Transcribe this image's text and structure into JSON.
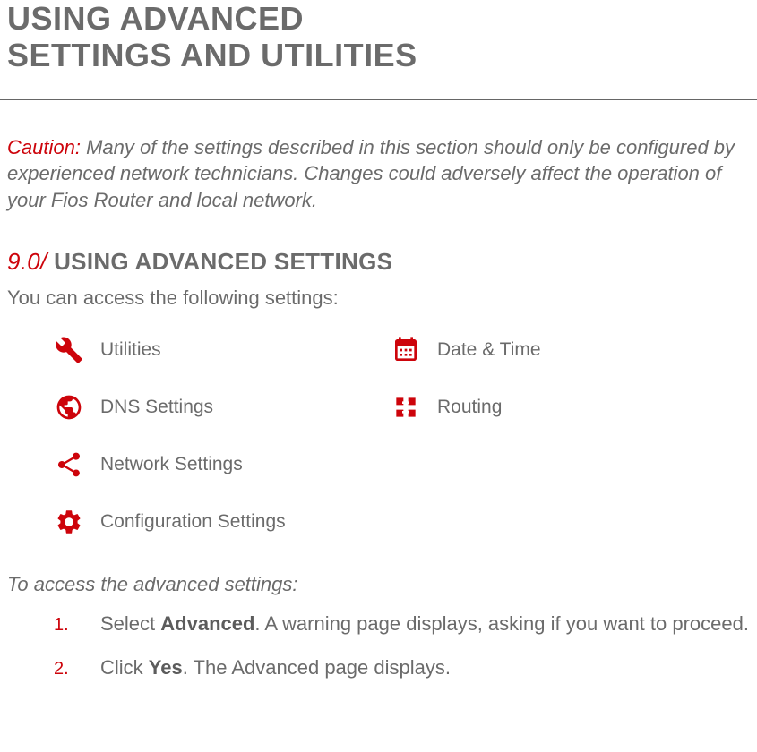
{
  "title_line1": "USING ADVANCED",
  "title_line2": "SETTINGS AND UTILITIES",
  "caution": {
    "label": "Caution:",
    "text": " Many of the settings described in this section should only be configured by experienced network technicians. Changes could adversely affect the operation of your Fios Router and local network."
  },
  "section": {
    "number": "9.0/",
    "title": " USING ADVANCED SETTINGS"
  },
  "intro": "You can access the following settings:",
  "items": {
    "utilities": "Utilities",
    "date_time": "Date & Time",
    "dns": "DNS Settings",
    "routing": "Routing",
    "network": "Network Settings",
    "config": "Configuration Settings"
  },
  "subheading": "To access the advanced settings:",
  "steps": {
    "s1_a": "Select ",
    "s1_b": "Advanced",
    "s1_c": ". A warning page displays, asking if you want to proceed.",
    "s2_a": "Click ",
    "s2_b": "Yes",
    "s2_c": ". The Advanced page displays."
  }
}
